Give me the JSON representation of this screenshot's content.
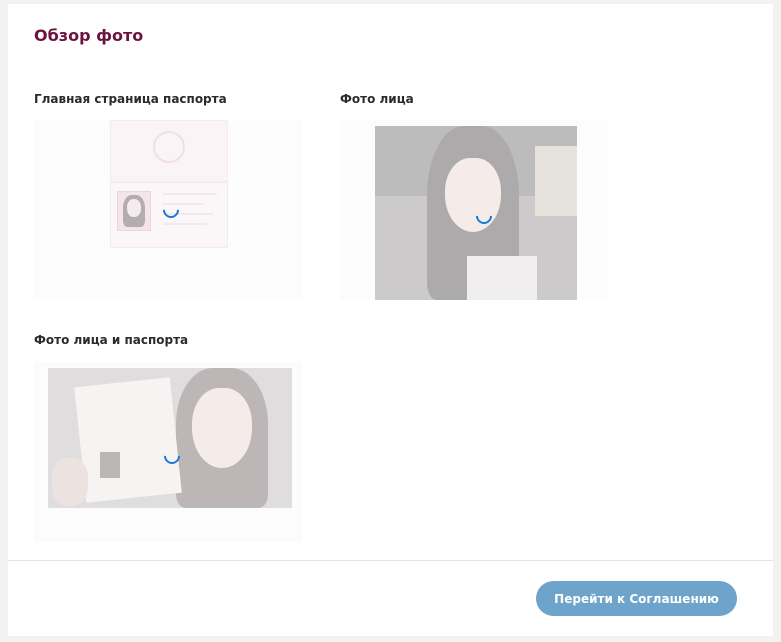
{
  "header": {
    "title": "Обзор фото"
  },
  "sections": [
    {
      "label": "Главная страница паспорта"
    },
    {
      "label": "Фото лица"
    },
    {
      "label": "Фото лица и паспорта"
    }
  ],
  "footer": {
    "next_label": "Перейти к Соглашению"
  },
  "colors": {
    "title": "#6b1340",
    "button": "#6ea3cc",
    "spinner": "#1a7ad6"
  }
}
